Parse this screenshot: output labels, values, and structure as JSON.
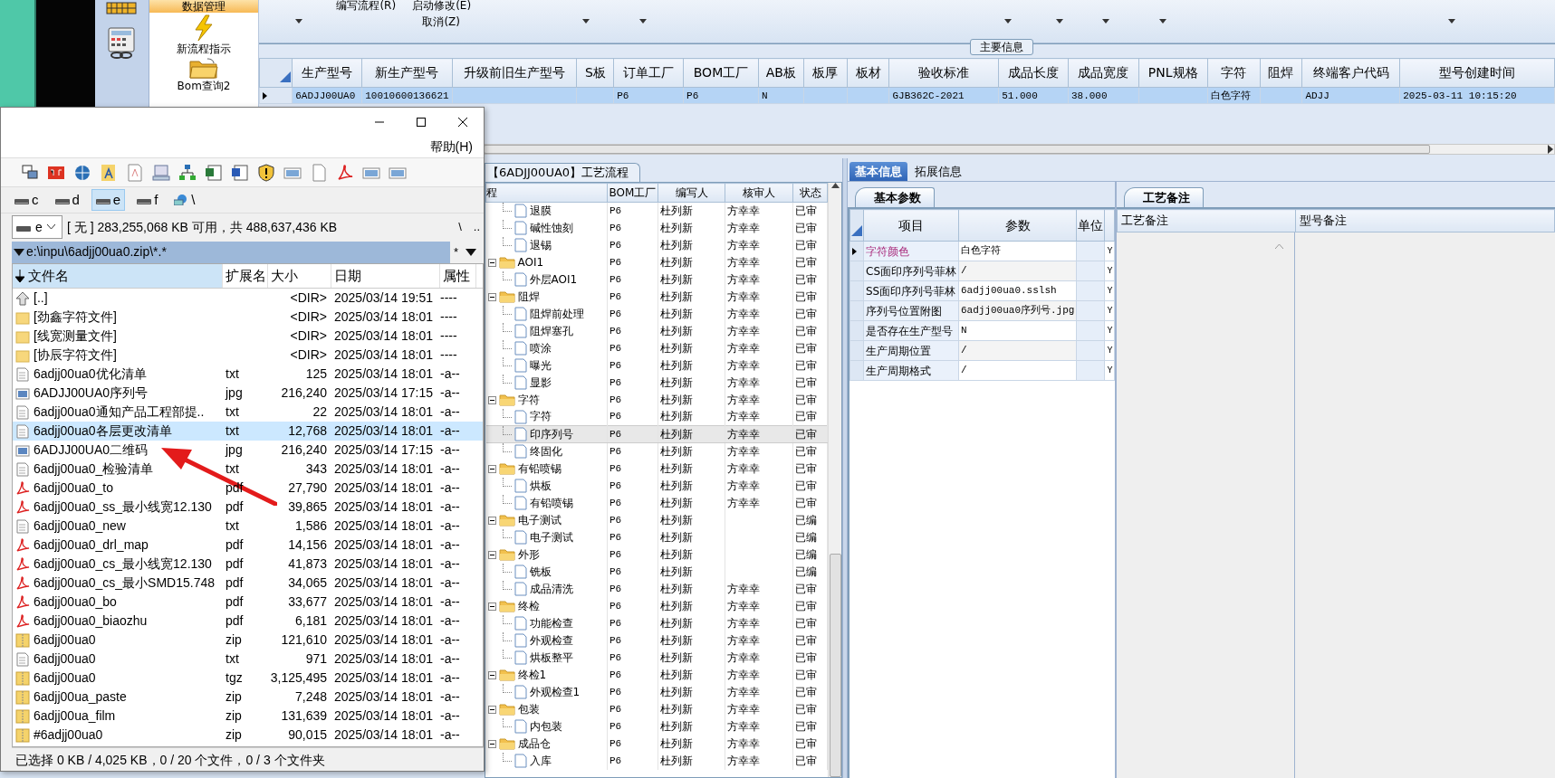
{
  "ribbon": {
    "commands": [
      {
        "label": "编写流程(R)"
      },
      {
        "label": "启动修改(E)"
      },
      {
        "label": "取消(Z)"
      }
    ],
    "group_label": "数据管理",
    "buttons": [
      {
        "label": "新流程指示",
        "kind": "lightning"
      },
      {
        "label": "Bom查询2",
        "kind": "folder"
      }
    ]
  },
  "main_info": {
    "title": "主要信息",
    "row_selected": true,
    "columns": [
      {
        "header": "生产型号",
        "cell": "6ADJJ00UA0"
      },
      {
        "header": "新生产型号",
        "cell": "10010600136621"
      },
      {
        "header": "升级前旧生产型号"
      },
      {
        "header": "S板"
      },
      {
        "header": "订单工厂",
        "cell": "P6"
      },
      {
        "header": "BOM工厂",
        "cell": "P6"
      },
      {
        "header": "AB板",
        "cell": "N"
      },
      {
        "header": "板厚"
      },
      {
        "header": "板材"
      },
      {
        "header": "验收标准",
        "cell": "GJB362C-2021"
      },
      {
        "header": "成品长度",
        "cell": "51.000"
      },
      {
        "header": "成品宽度",
        "cell": "38.000"
      },
      {
        "header": "PNL规格"
      },
      {
        "header": "字符",
        "cell": "白色字符"
      },
      {
        "header": "阻焊"
      },
      {
        "header": "终端客户代码",
        "cell": "ADJJ"
      },
      {
        "header": "型号创建时间",
        "cell": "2025-03-11 10:15:20"
      }
    ]
  },
  "process_flow": {
    "title": "【6ADJJ00UA0】工艺流程",
    "columns": [
      "程",
      "BOM工厂",
      "编写人",
      "核审人",
      "状态"
    ],
    "rows": [
      {
        "kind": "step",
        "name": "退膜",
        "bom": "P6",
        "writer": "杜列新",
        "reviewer": "方幸幸",
        "status": "已审",
        "selected": false
      },
      {
        "kind": "step",
        "name": "碱性蚀刻",
        "bom": "P6",
        "writer": "杜列新",
        "reviewer": "方幸幸",
        "status": "已审",
        "selected": false
      },
      {
        "kind": "step",
        "name": "退锡",
        "bom": "P6",
        "writer": "杜列新",
        "reviewer": "方幸幸",
        "status": "已审",
        "selected": false
      },
      {
        "kind": "group",
        "name": "AOI1",
        "bom": "P6",
        "writer": "杜列新",
        "reviewer": "方幸幸",
        "status": "已审",
        "selected": false,
        "children": [
          {
            "kind": "step",
            "name": "外层AOI1",
            "bom": "P6",
            "writer": "杜列新",
            "reviewer": "方幸幸",
            "status": "已审",
            "selected": false
          }
        ]
      },
      {
        "kind": "group",
        "name": "阻焊",
        "bom": "P6",
        "writer": "杜列新",
        "reviewer": "方幸幸",
        "status": "已审",
        "selected": false,
        "children": [
          {
            "kind": "step",
            "name": "阻焊前处理",
            "bom": "P6",
            "writer": "杜列新",
            "reviewer": "方幸幸",
            "status": "已审",
            "selected": false
          },
          {
            "kind": "step",
            "name": "阻焊塞孔",
            "bom": "P6",
            "writer": "杜列新",
            "reviewer": "方幸幸",
            "status": "已审",
            "selected": false
          },
          {
            "kind": "step",
            "name": "喷涂",
            "bom": "P6",
            "writer": "杜列新",
            "reviewer": "方幸幸",
            "status": "已审",
            "selected": false
          },
          {
            "kind": "step",
            "name": "曝光",
            "bom": "P6",
            "writer": "杜列新",
            "reviewer": "方幸幸",
            "status": "已审",
            "selected": false
          },
          {
            "kind": "step",
            "name": "显影",
            "bom": "P6",
            "writer": "杜列新",
            "reviewer": "方幸幸",
            "status": "已审",
            "selected": false
          }
        ]
      },
      {
        "kind": "group",
        "name": "字符",
        "bom": "P6",
        "writer": "杜列新",
        "reviewer": "方幸幸",
        "status": "已审",
        "selected": false,
        "children": [
          {
            "kind": "step",
            "name": "字符",
            "bom": "P6",
            "writer": "杜列新",
            "reviewer": "方幸幸",
            "status": "已审",
            "selected": false
          },
          {
            "kind": "step",
            "name": "印序列号",
            "bom": "P6",
            "writer": "杜列新",
            "reviewer": "方幸幸",
            "status": "已审",
            "selected": true
          },
          {
            "kind": "step",
            "name": "终固化",
            "bom": "P6",
            "writer": "杜列新",
            "reviewer": "方幸幸",
            "status": "已审",
            "selected": false
          }
        ]
      },
      {
        "kind": "group",
        "name": "有铅喷锡",
        "bom": "P6",
        "writer": "杜列新",
        "reviewer": "方幸幸",
        "status": "已审",
        "selected": false,
        "children": [
          {
            "kind": "step",
            "name": "烘板",
            "bom": "P6",
            "writer": "杜列新",
            "reviewer": "方幸幸",
            "status": "已审",
            "selected": false
          },
          {
            "kind": "step",
            "name": "有铅喷锡",
            "bom": "P6",
            "writer": "杜列新",
            "reviewer": "方幸幸",
            "status": "已审",
            "selected": false
          }
        ]
      },
      {
        "kind": "group",
        "name": "电子测试",
        "bom": "P6",
        "writer": "杜列新",
        "status": "已编",
        "selected": false,
        "children": [
          {
            "kind": "step",
            "name": "电子测试",
            "bom": "P6",
            "writer": "杜列新",
            "status": "已编",
            "selected": false
          }
        ]
      },
      {
        "kind": "group",
        "name": "外形",
        "bom": "P6",
        "writer": "杜列新",
        "status": "已编",
        "selected": false,
        "children": [
          {
            "kind": "step",
            "name": "铣板",
            "bom": "P6",
            "writer": "杜列新",
            "status": "已编",
            "selected": false
          },
          {
            "kind": "step",
            "name": "成品清洗",
            "bom": "P6",
            "writer": "杜列新",
            "reviewer": "方幸幸",
            "status": "已审",
            "selected": false
          }
        ]
      },
      {
        "kind": "group",
        "name": "终检",
        "bom": "P6",
        "writer": "杜列新",
        "reviewer": "方幸幸",
        "status": "已审",
        "selected": false,
        "children": [
          {
            "kind": "step",
            "name": "功能检查",
            "bom": "P6",
            "writer": "杜列新",
            "reviewer": "方幸幸",
            "status": "已审",
            "selected": false
          },
          {
            "kind": "step",
            "name": "外观检查",
            "bom": "P6",
            "writer": "杜列新",
            "reviewer": "方幸幸",
            "status": "已审",
            "selected": false
          },
          {
            "kind": "step",
            "name": "烘板整平",
            "bom": "P6",
            "writer": "杜列新",
            "reviewer": "方幸幸",
            "status": "已审",
            "selected": false
          }
        ]
      },
      {
        "kind": "group",
        "name": "终检1",
        "bom": "P6",
        "writer": "杜列新",
        "reviewer": "方幸幸",
        "status": "已审",
        "selected": false,
        "children": [
          {
            "kind": "step",
            "name": "外观检查1",
            "bom": "P6",
            "writer": "杜列新",
            "reviewer": "方幸幸",
            "status": "已审",
            "selected": false
          }
        ]
      },
      {
        "kind": "group",
        "name": "包装",
        "bom": "P6",
        "writer": "杜列新",
        "reviewer": "方幸幸",
        "status": "已审",
        "selected": false,
        "children": [
          {
            "kind": "step",
            "name": "内包装",
            "bom": "P6",
            "writer": "杜列新",
            "reviewer": "方幸幸",
            "status": "已审",
            "selected": false
          }
        ]
      },
      {
        "kind": "group",
        "name": "成品仓",
        "bom": "P6",
        "writer": "杜列新",
        "reviewer": "方幸幸",
        "status": "已审",
        "selected": false,
        "children": [
          {
            "kind": "step",
            "name": "入库",
            "bom": "P6",
            "writer": "杜列新",
            "reviewer": "方幸幸",
            "status": "已审",
            "selected": false
          }
        ]
      }
    ]
  },
  "detail": {
    "tabs": [
      {
        "label": "基本信息",
        "selected": true
      },
      {
        "label": "拓展信息",
        "selected": false
      }
    ],
    "params": {
      "tab": "基本参数",
      "columns": [
        "项目",
        "参数",
        "单位"
      ],
      "rows": [
        {
          "item": "字符颜色",
          "value": "白色字符",
          "flag": "Y",
          "selected": true
        },
        {
          "item": "CS面印序列号菲林",
          "value": "/",
          "flag": "Y",
          "selected": false
        },
        {
          "item": "SS面印序列号菲林",
          "value": "6adjj00ua0.sslsh",
          "flag": "Y",
          "selected": false
        },
        {
          "item": "序列号位置附图",
          "value": "6adjj00ua0序列号.jpg",
          "flag": "Y",
          "selected": false
        },
        {
          "item": "是否存在生产型号",
          "value": "N",
          "flag": "Y",
          "selected": false
        },
        {
          "item": "生产周期位置",
          "value": "/",
          "flag": "Y",
          "selected": false
        },
        {
          "item": "生产周期格式",
          "value": "/",
          "flag": "Y",
          "selected": false
        }
      ]
    },
    "notes": {
      "tab": "工艺备注",
      "columns": [
        "工艺备注",
        "型号备注"
      ]
    }
  },
  "file_manager": {
    "menu": [
      {
        "label": "帮助(H)"
      }
    ],
    "drives": [
      {
        "label": "c",
        "selected": false
      },
      {
        "label": "d",
        "selected": false
      },
      {
        "label": "e",
        "selected": true
      },
      {
        "label": "f",
        "selected": false
      },
      {
        "label": "\\",
        "selected": false
      }
    ],
    "drive_combo": "e",
    "disk_info": "[ 无 ]  283,255,068 KB 可用，共 488,637,436 KB",
    "root_button": "\\",
    "up_button": "..",
    "path": "e:\\inpu\\6adjj00ua0.zip\\*.*",
    "filter": "*",
    "columns": [
      "文件名",
      "扩展名",
      "大小",
      "日期",
      "属性"
    ],
    "files": [
      {
        "kind": "up",
        "name": "[..]",
        "size": "<DIR>",
        "date": "2025/03/14 19:51",
        "attr": "----",
        "selected": false
      },
      {
        "kind": "folder",
        "name": "[劲鑫字符文件]",
        "size": "<DIR>",
        "date": "2025/03/14 18:01",
        "attr": "----",
        "selected": false
      },
      {
        "kind": "folder",
        "name": "[线宽测量文件]",
        "size": "<DIR>",
        "date": "2025/03/14 18:01",
        "attr": "----",
        "selected": false
      },
      {
        "kind": "folder",
        "name": "[协辰字符文件]",
        "size": "<DIR>",
        "date": "2025/03/14 18:01",
        "attr": "----",
        "selected": false
      },
      {
        "kind": "text",
        "name": "6adjj00ua0优化清单",
        "ext": "txt",
        "size": "125",
        "date": "2025/03/14 18:01",
        "attr": "-a--",
        "selected": false
      },
      {
        "kind": "image",
        "name": "6ADJJ00UA0序列号",
        "ext": "jpg",
        "size": "216,240",
        "date": "2025/03/14 17:15",
        "attr": "-a--",
        "selected": false
      },
      {
        "kind": "text",
        "name": "6adjj00ua0通知产品工程部提..",
        "ext": "txt",
        "size": "22",
        "date": "2025/03/14 18:01",
        "attr": "-a--",
        "selected": false
      },
      {
        "kind": "text",
        "name": "6adjj00ua0各层更改清单",
        "ext": "txt",
        "size": "12,768",
        "date": "2025/03/14 18:01",
        "attr": "-a--",
        "selected": true
      },
      {
        "kind": "image",
        "name": "6ADJJ00UA0二维码",
        "ext": "jpg",
        "size": "216,240",
        "date": "2025/03/14 17:15",
        "attr": "-a--",
        "selected": false
      },
      {
        "kind": "text",
        "name": "6adjj00ua0_检验清单",
        "ext": "txt",
        "size": "343",
        "date": "2025/03/14 18:01",
        "attr": "-a--",
        "selected": false
      },
      {
        "kind": "pdf",
        "name": "6adjj00ua0_to",
        "ext": "pdf",
        "size": "27,790",
        "date": "2025/03/14 18:01",
        "attr": "-a--",
        "selected": false
      },
      {
        "kind": "pdf",
        "name": "6adjj00ua0_ss_最小线宽12.130",
        "ext": "pdf",
        "size": "39,865",
        "date": "2025/03/14 18:01",
        "attr": "-a--",
        "selected": false
      },
      {
        "kind": "text",
        "name": "6adjj00ua0_new",
        "ext": "txt",
        "size": "1,586",
        "date": "2025/03/14 18:01",
        "attr": "-a--",
        "selected": false
      },
      {
        "kind": "pdf",
        "name": "6adjj00ua0_drl_map",
        "ext": "pdf",
        "size": "14,156",
        "date": "2025/03/14 18:01",
        "attr": "-a--",
        "selected": false
      },
      {
        "kind": "pdf",
        "name": "6adjj00ua0_cs_最小线宽12.130",
        "ext": "pdf",
        "size": "41,873",
        "date": "2025/03/14 18:01",
        "attr": "-a--",
        "selected": false
      },
      {
        "kind": "pdf",
        "name": "6adjj00ua0_cs_最小SMD15.748",
        "ext": "pdf",
        "size": "34,065",
        "date": "2025/03/14 18:01",
        "attr": "-a--",
        "selected": false
      },
      {
        "kind": "pdf",
        "name": "6adjj00ua0_bo",
        "ext": "pdf",
        "size": "33,677",
        "date": "2025/03/14 18:01",
        "attr": "-a--",
        "selected": false
      },
      {
        "kind": "pdf",
        "name": "6adjj00ua0_biaozhu",
        "ext": "pdf",
        "size": "6,181",
        "date": "2025/03/14 18:01",
        "attr": "-a--",
        "selected": false
      },
      {
        "kind": "archive",
        "name": "6adjj00ua0",
        "ext": "zip",
        "size": "121,610",
        "date": "2025/03/14 18:01",
        "attr": "-a--",
        "selected": false
      },
      {
        "kind": "text",
        "name": "6adjj00ua0",
        "ext": "txt",
        "size": "971",
        "date": "2025/03/14 18:01",
        "attr": "-a--",
        "selected": false
      },
      {
        "kind": "archive",
        "name": "6adjj00ua0",
        "ext": "tgz",
        "size": "3,125,495",
        "date": "2025/03/14 18:01",
        "attr": "-a--",
        "selected": false
      },
      {
        "kind": "archive",
        "name": "6adjj00ua_paste",
        "ext": "zip",
        "size": "7,248",
        "date": "2025/03/14 18:01",
        "attr": "-a--",
        "selected": false
      },
      {
        "kind": "archive",
        "name": "6adjj00ua_film",
        "ext": "zip",
        "size": "131,639",
        "date": "2025/03/14 18:01",
        "attr": "-a--",
        "selected": false
      },
      {
        "kind": "archive",
        "name": "#6adjj00ua0",
        "ext": "zip",
        "size": "90,015",
        "date": "2025/03/14 18:01",
        "attr": "-a--",
        "selected": false
      }
    ],
    "status": "已选择 0 KB / 4,025 KB，0 / 20 个文件，0 / 3 个文件夹"
  }
}
